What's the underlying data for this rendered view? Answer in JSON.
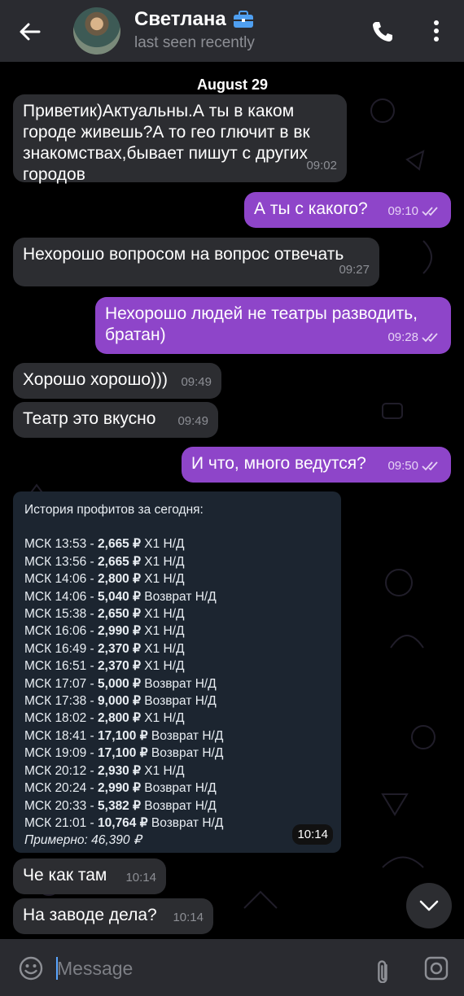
{
  "header": {
    "back_icon": "arrow-left-icon",
    "name": "Светлана",
    "badge_icon": "briefcase-icon",
    "status": "last seen recently",
    "call_icon": "phone-icon",
    "menu_icon": "more-vert-icon"
  },
  "chat": {
    "date": "August 29",
    "messages": [
      {
        "dir": "in",
        "text": "Приветик)Актуальны.А ты в каком городе живешь?А то гео глючит в вк знакомствах,бывает пишут с других городов",
        "time": "09:02"
      },
      {
        "dir": "out",
        "text": "А ты с какого?",
        "time": "09:10"
      },
      {
        "dir": "in",
        "text": "Нехорошо вопросом на вопрос отвечать",
        "time": "09:27"
      },
      {
        "dir": "out",
        "text": "Нехорошо людей не театры разводить, братан)",
        "time": "09:28"
      },
      {
        "dir": "in",
        "text": "Хорошо хорошо)))",
        "time": "09:49"
      },
      {
        "dir": "in",
        "text": "Театр это вкусно",
        "time": "09:49"
      },
      {
        "dir": "out",
        "text": "И что, много ведутся?",
        "time": "09:50"
      },
      {
        "dir": "in",
        "text": "Че как там",
        "time": "10:14"
      },
      {
        "dir": "in",
        "text": "На заводе дела?",
        "time": "10:14"
      }
    ],
    "profits": {
      "title": "История профитов за сегодня:",
      "rows": [
        {
          "time": "МСК 13:53",
          "amount": "2,665 ₽",
          "kind": "Х1 Н/Д"
        },
        {
          "time": "МСК 13:56",
          "amount": "2,665 ₽",
          "kind": "Х1 Н/Д"
        },
        {
          "time": "МСК 14:06",
          "amount": "2,800 ₽",
          "kind": "Х1 Н/Д"
        },
        {
          "time": "МСК 14:06",
          "amount": "5,040 ₽",
          "kind": "Возврат Н/Д"
        },
        {
          "time": "МСК 15:38",
          "amount": "2,650 ₽",
          "kind": "Х1 Н/Д"
        },
        {
          "time": "МСК 16:06",
          "amount": "2,990 ₽",
          "kind": "Х1 Н/Д"
        },
        {
          "time": "МСК 16:49",
          "amount": "2,370 ₽",
          "kind": "Х1 Н/Д"
        },
        {
          "time": "МСК 16:51",
          "amount": "2,370 ₽",
          "kind": "Х1 Н/Д"
        },
        {
          "time": "МСК 17:07",
          "amount": "5,000 ₽",
          "kind": "Возврат Н/Д"
        },
        {
          "time": "МСК 17:38",
          "amount": "9,000 ₽",
          "kind": "Возврат Н/Д"
        },
        {
          "time": "МСК 18:02",
          "amount": "2,800 ₽",
          "kind": "Х1 Н/Д"
        },
        {
          "time": "МСК 18:41",
          "amount": "17,100 ₽",
          "kind": "Возврат Н/Д"
        },
        {
          "time": "МСК 19:09",
          "amount": "17,100 ₽",
          "kind": "Возврат Н/Д"
        },
        {
          "time": "МСК 20:12",
          "amount": "2,930 ₽",
          "kind": "Х1 Н/Д"
        },
        {
          "time": "МСК 20:24",
          "amount": "2,990 ₽",
          "kind": "Возврат Н/Д"
        },
        {
          "time": "МСК 20:33",
          "amount": "5,382 ₽",
          "kind": "Возврат Н/Д"
        },
        {
          "time": "МСК 21:01",
          "amount": "10,764 ₽",
          "kind": "Возврат Н/Д"
        }
      ],
      "approx": "Примерно: 46,390 ₽",
      "time": "10:14"
    },
    "scroll_icon": "chevron-down-icon"
  },
  "input": {
    "emoji_icon": "smile-icon",
    "placeholder": "Message",
    "attach_icon": "paperclip-icon",
    "camera_icon": "camera-icon"
  },
  "colors": {
    "header_bg": "#2a2b30",
    "incoming_bubble": "#2c2d31",
    "outgoing_bubble": "#8e45c9",
    "forward_card": "#1c2530"
  }
}
